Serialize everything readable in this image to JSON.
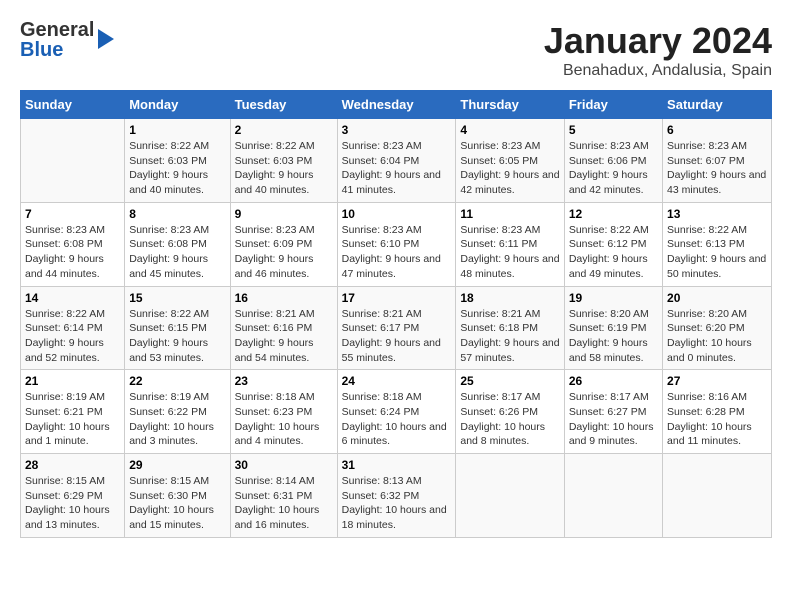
{
  "logo": {
    "general": "General",
    "blue": "Blue"
  },
  "title": "January 2024",
  "subtitle": "Benahadux, Andalusia, Spain",
  "columns": [
    "Sunday",
    "Monday",
    "Tuesday",
    "Wednesday",
    "Thursday",
    "Friday",
    "Saturday"
  ],
  "weeks": [
    [
      {
        "day": "",
        "sunrise": "",
        "sunset": "",
        "daylight": ""
      },
      {
        "day": "1",
        "sunrise": "Sunrise: 8:22 AM",
        "sunset": "Sunset: 6:03 PM",
        "daylight": "Daylight: 9 hours and 40 minutes."
      },
      {
        "day": "2",
        "sunrise": "Sunrise: 8:22 AM",
        "sunset": "Sunset: 6:03 PM",
        "daylight": "Daylight: 9 hours and 40 minutes."
      },
      {
        "day": "3",
        "sunrise": "Sunrise: 8:23 AM",
        "sunset": "Sunset: 6:04 PM",
        "daylight": "Daylight: 9 hours and 41 minutes."
      },
      {
        "day": "4",
        "sunrise": "Sunrise: 8:23 AM",
        "sunset": "Sunset: 6:05 PM",
        "daylight": "Daylight: 9 hours and 42 minutes."
      },
      {
        "day": "5",
        "sunrise": "Sunrise: 8:23 AM",
        "sunset": "Sunset: 6:06 PM",
        "daylight": "Daylight: 9 hours and 42 minutes."
      },
      {
        "day": "6",
        "sunrise": "Sunrise: 8:23 AM",
        "sunset": "Sunset: 6:07 PM",
        "daylight": "Daylight: 9 hours and 43 minutes."
      }
    ],
    [
      {
        "day": "7",
        "sunrise": "Sunrise: 8:23 AM",
        "sunset": "Sunset: 6:08 PM",
        "daylight": "Daylight: 9 hours and 44 minutes."
      },
      {
        "day": "8",
        "sunrise": "Sunrise: 8:23 AM",
        "sunset": "Sunset: 6:08 PM",
        "daylight": "Daylight: 9 hours and 45 minutes."
      },
      {
        "day": "9",
        "sunrise": "Sunrise: 8:23 AM",
        "sunset": "Sunset: 6:09 PM",
        "daylight": "Daylight: 9 hours and 46 minutes."
      },
      {
        "day": "10",
        "sunrise": "Sunrise: 8:23 AM",
        "sunset": "Sunset: 6:10 PM",
        "daylight": "Daylight: 9 hours and 47 minutes."
      },
      {
        "day": "11",
        "sunrise": "Sunrise: 8:23 AM",
        "sunset": "Sunset: 6:11 PM",
        "daylight": "Daylight: 9 hours and 48 minutes."
      },
      {
        "day": "12",
        "sunrise": "Sunrise: 8:22 AM",
        "sunset": "Sunset: 6:12 PM",
        "daylight": "Daylight: 9 hours and 49 minutes."
      },
      {
        "day": "13",
        "sunrise": "Sunrise: 8:22 AM",
        "sunset": "Sunset: 6:13 PM",
        "daylight": "Daylight: 9 hours and 50 minutes."
      }
    ],
    [
      {
        "day": "14",
        "sunrise": "Sunrise: 8:22 AM",
        "sunset": "Sunset: 6:14 PM",
        "daylight": "Daylight: 9 hours and 52 minutes."
      },
      {
        "day": "15",
        "sunrise": "Sunrise: 8:22 AM",
        "sunset": "Sunset: 6:15 PM",
        "daylight": "Daylight: 9 hours and 53 minutes."
      },
      {
        "day": "16",
        "sunrise": "Sunrise: 8:21 AM",
        "sunset": "Sunset: 6:16 PM",
        "daylight": "Daylight: 9 hours and 54 minutes."
      },
      {
        "day": "17",
        "sunrise": "Sunrise: 8:21 AM",
        "sunset": "Sunset: 6:17 PM",
        "daylight": "Daylight: 9 hours and 55 minutes."
      },
      {
        "day": "18",
        "sunrise": "Sunrise: 8:21 AM",
        "sunset": "Sunset: 6:18 PM",
        "daylight": "Daylight: 9 hours and 57 minutes."
      },
      {
        "day": "19",
        "sunrise": "Sunrise: 8:20 AM",
        "sunset": "Sunset: 6:19 PM",
        "daylight": "Daylight: 9 hours and 58 minutes."
      },
      {
        "day": "20",
        "sunrise": "Sunrise: 8:20 AM",
        "sunset": "Sunset: 6:20 PM",
        "daylight": "Daylight: 10 hours and 0 minutes."
      }
    ],
    [
      {
        "day": "21",
        "sunrise": "Sunrise: 8:19 AM",
        "sunset": "Sunset: 6:21 PM",
        "daylight": "Daylight: 10 hours and 1 minute."
      },
      {
        "day": "22",
        "sunrise": "Sunrise: 8:19 AM",
        "sunset": "Sunset: 6:22 PM",
        "daylight": "Daylight: 10 hours and 3 minutes."
      },
      {
        "day": "23",
        "sunrise": "Sunrise: 8:18 AM",
        "sunset": "Sunset: 6:23 PM",
        "daylight": "Daylight: 10 hours and 4 minutes."
      },
      {
        "day": "24",
        "sunrise": "Sunrise: 8:18 AM",
        "sunset": "Sunset: 6:24 PM",
        "daylight": "Daylight: 10 hours and 6 minutes."
      },
      {
        "day": "25",
        "sunrise": "Sunrise: 8:17 AM",
        "sunset": "Sunset: 6:26 PM",
        "daylight": "Daylight: 10 hours and 8 minutes."
      },
      {
        "day": "26",
        "sunrise": "Sunrise: 8:17 AM",
        "sunset": "Sunset: 6:27 PM",
        "daylight": "Daylight: 10 hours and 9 minutes."
      },
      {
        "day": "27",
        "sunrise": "Sunrise: 8:16 AM",
        "sunset": "Sunset: 6:28 PM",
        "daylight": "Daylight: 10 hours and 11 minutes."
      }
    ],
    [
      {
        "day": "28",
        "sunrise": "Sunrise: 8:15 AM",
        "sunset": "Sunset: 6:29 PM",
        "daylight": "Daylight: 10 hours and 13 minutes."
      },
      {
        "day": "29",
        "sunrise": "Sunrise: 8:15 AM",
        "sunset": "Sunset: 6:30 PM",
        "daylight": "Daylight: 10 hours and 15 minutes."
      },
      {
        "day": "30",
        "sunrise": "Sunrise: 8:14 AM",
        "sunset": "Sunset: 6:31 PM",
        "daylight": "Daylight: 10 hours and 16 minutes."
      },
      {
        "day": "31",
        "sunrise": "Sunrise: 8:13 AM",
        "sunset": "Sunset: 6:32 PM",
        "daylight": "Daylight: 10 hours and 18 minutes."
      },
      {
        "day": "",
        "sunrise": "",
        "sunset": "",
        "daylight": ""
      },
      {
        "day": "",
        "sunrise": "",
        "sunset": "",
        "daylight": ""
      },
      {
        "day": "",
        "sunrise": "",
        "sunset": "",
        "daylight": ""
      }
    ]
  ]
}
